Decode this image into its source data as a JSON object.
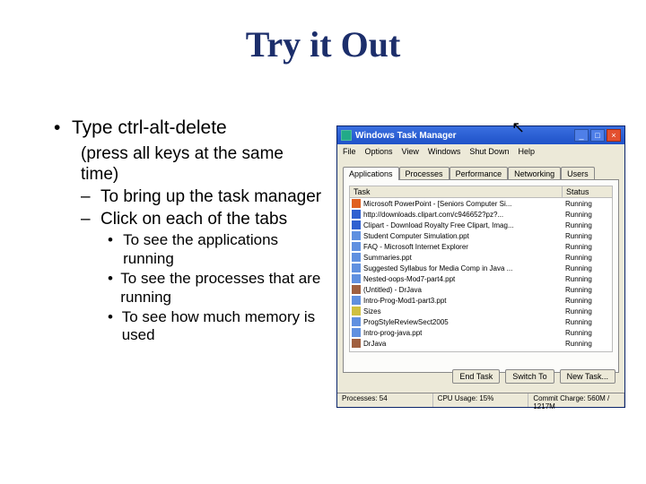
{
  "title": "Try it Out",
  "bullets": {
    "b1": "Type ctrl-alt-delete",
    "sub_paren": "(press all keys at the same time)",
    "d1": "To bring up the task manager",
    "d2": "Click on each of the tabs",
    "s1": "To see the applications running",
    "s2": "To see the processes that are running",
    "s3": "To see how much memory is used"
  },
  "tm": {
    "title": "Windows Task Manager",
    "menus": [
      "File",
      "Options",
      "View",
      "Windows",
      "Shut Down",
      "Help"
    ],
    "tabs": [
      "Applications",
      "Processes",
      "Performance",
      "Networking",
      "Users"
    ],
    "cols": {
      "task": "Task",
      "status": "Status"
    },
    "buttons": {
      "end": "End Task",
      "switch": "Switch To",
      "new": "New Task..."
    },
    "status": {
      "p": "Processes: 54",
      "c": "CPU Usage: 15%",
      "m": "Commit Charge: 560M / 1217M"
    },
    "rows": [
      {
        "ic": "ppt",
        "t": "Microsoft PowerPoint - [Seniors Computer Si...",
        "s": "Running"
      },
      {
        "ic": "ie",
        "t": "http://downloads.clipart.com/c946652?pz?...",
        "s": "Running"
      },
      {
        "ic": "ie",
        "t": "Clipart - Download Royalty Free Clipart, Imag...",
        "s": "Running"
      },
      {
        "ic": "doc",
        "t": "Student Computer Simulation.ppt",
        "s": "Running"
      },
      {
        "ic": "doc",
        "t": "FAQ - Microsoft Internet Explorer",
        "s": "Running"
      },
      {
        "ic": "doc",
        "t": "Summaries.ppt",
        "s": "Running"
      },
      {
        "ic": "doc",
        "t": "Suggested Syllabus for Media Comp in Java ...",
        "s": "Running"
      },
      {
        "ic": "doc",
        "t": "Nested-oops-Mod7-part4.ppt",
        "s": "Running"
      },
      {
        "ic": "j",
        "t": "(Untitled) - DrJava",
        "s": "Running"
      },
      {
        "ic": "doc",
        "t": "Intro-Prog-Mod1-part3.ppt",
        "s": "Running"
      },
      {
        "ic": "f",
        "t": "Sizes",
        "s": "Running"
      },
      {
        "ic": "doc",
        "t": "ProgStyleReviewSect2005",
        "s": "Running"
      },
      {
        "ic": "doc",
        "t": "Intro-prog-java.ppt",
        "s": "Running"
      },
      {
        "ic": "j",
        "t": "DrJava",
        "s": "Running"
      }
    ]
  }
}
